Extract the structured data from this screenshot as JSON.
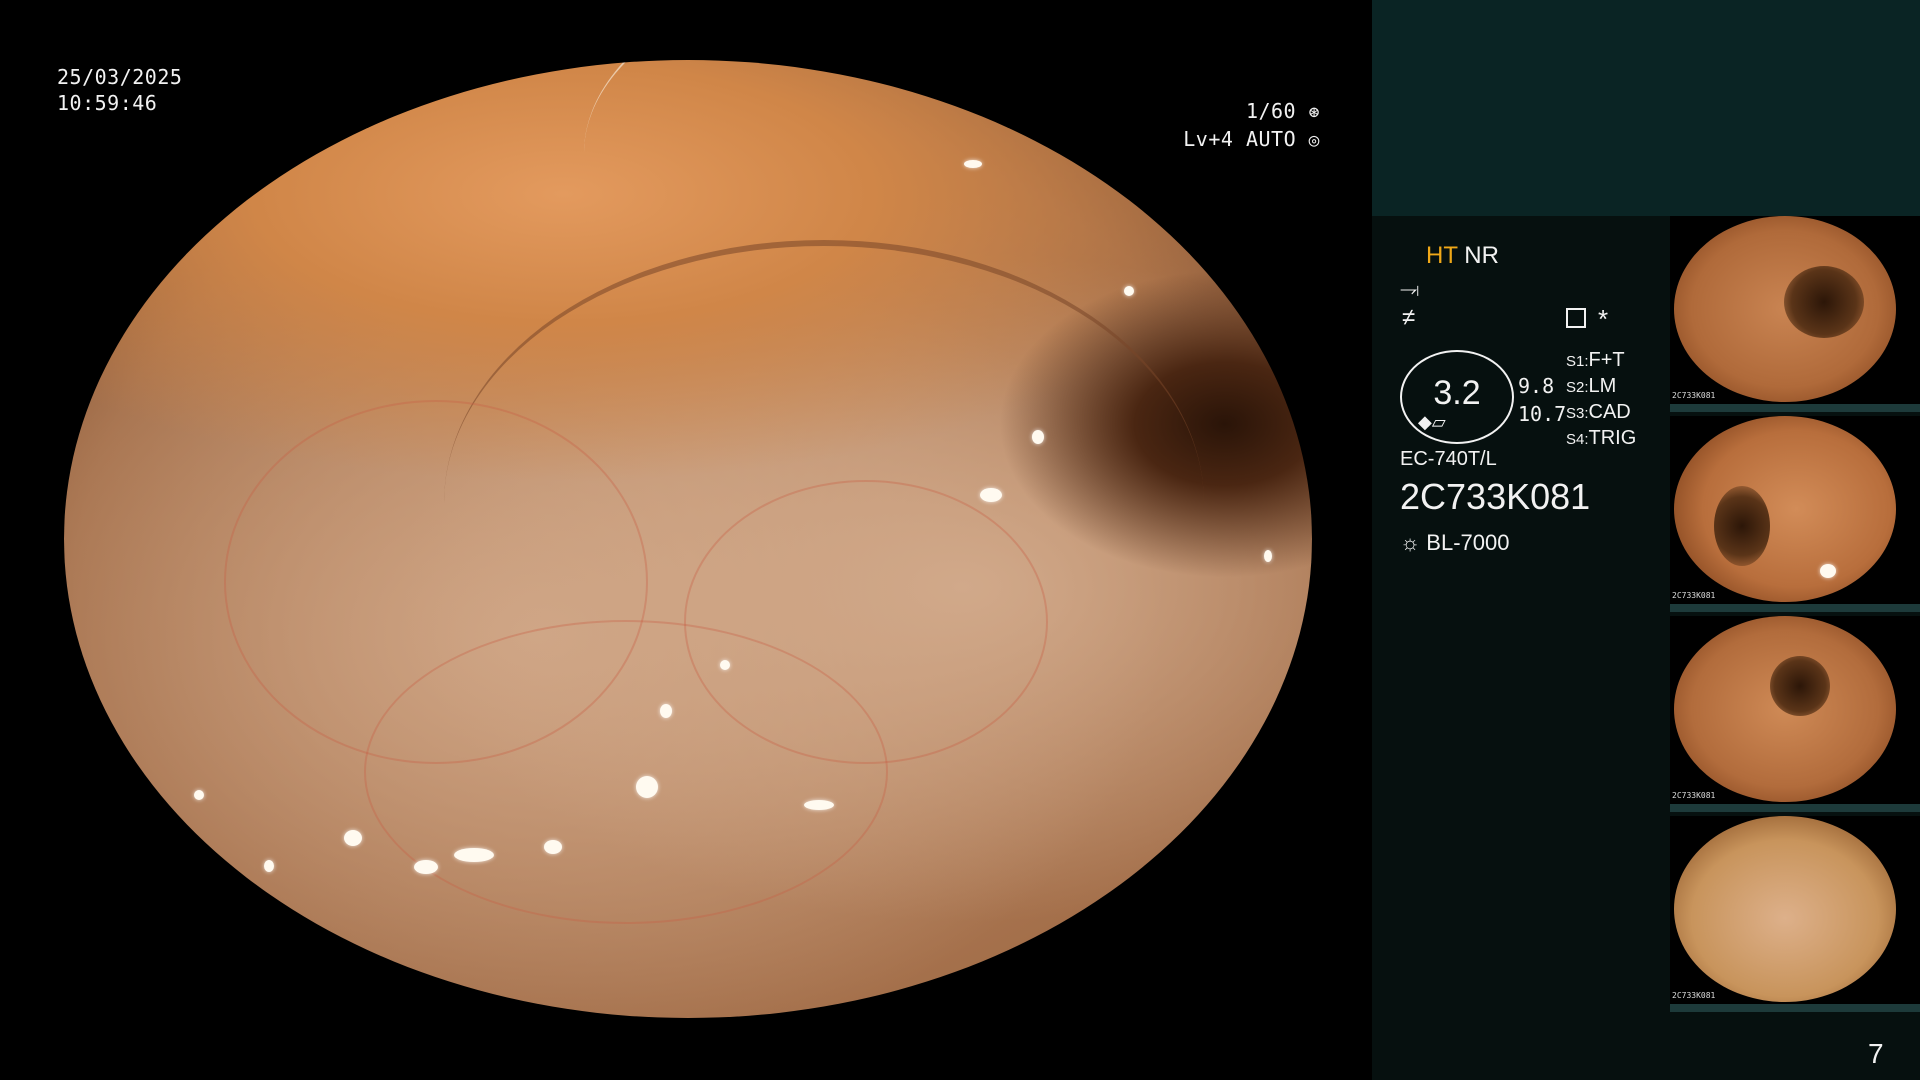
{
  "overlay": {
    "date": "25/03/2025",
    "time": "10:59:46",
    "shutter": "1/60",
    "exposure": "Lv+4 AUTO"
  },
  "panel": {
    "ht": "HT",
    "nr": "NR",
    "asterisk": "*",
    "zoom": "3.2",
    "zoom_a": "9.8",
    "zoom_b": "10.7",
    "s1_key": "S1:",
    "s1_val": "F+T",
    "s2_key": "S2:",
    "s2_val": "LM",
    "s3_key": "S3:",
    "s3_val": "CAD",
    "s4_key": "S4:",
    "s4_val": "TRIG",
    "scope_model": "EC-740T/L",
    "serial": "2C733K081",
    "light_source": "BL-7000",
    "page_number": "7"
  },
  "icons": {
    "shutter": "aperture-icon",
    "exposure": "iris-icon",
    "enhance1": "curve-icon",
    "enhance2": "not-equal-icon",
    "settings": "settings-list-icon",
    "light": "sun-icon",
    "zoom_tools": "pen-icon"
  },
  "thumbnails": [
    {
      "code": "2C733K081"
    },
    {
      "code": "2C733K081"
    },
    {
      "code": "2C733K081"
    },
    {
      "code": "2C733K081"
    }
  ]
}
